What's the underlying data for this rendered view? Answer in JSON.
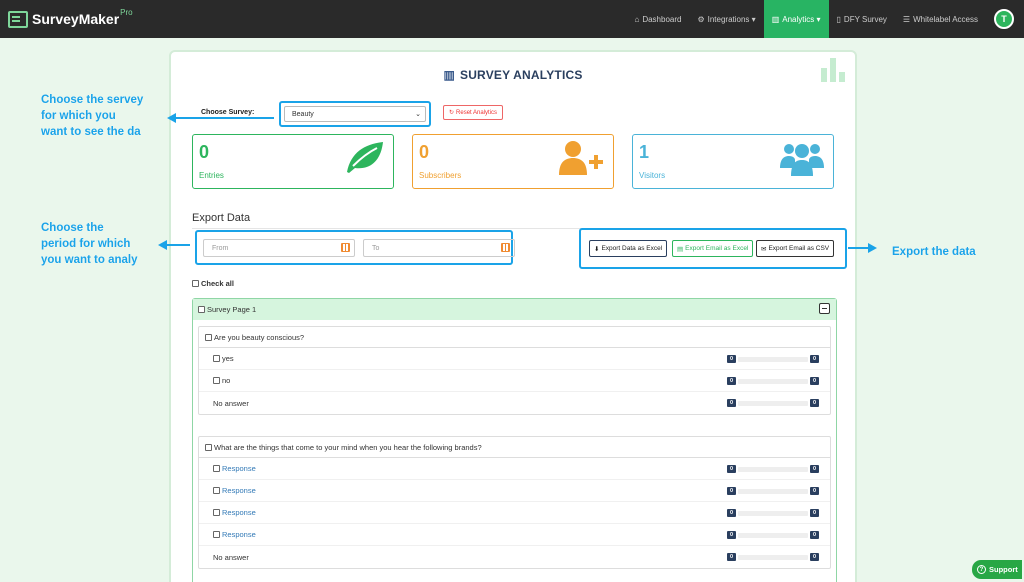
{
  "brand": {
    "name": "SurveyMaker",
    "tag": "Pro"
  },
  "nav": [
    {
      "icon": "home-icon",
      "glyph": "⌂",
      "label": "Dashboard",
      "caret": ""
    },
    {
      "icon": "cogs-icon",
      "glyph": "⚙",
      "label": "Integrations",
      "caret": "▾"
    },
    {
      "icon": "chart-icon",
      "glyph": "▥",
      "label": "Analytics",
      "caret": "▾"
    },
    {
      "icon": "file-icon",
      "glyph": "▯",
      "label": "DFY Survey",
      "caret": ""
    },
    {
      "icon": "list-icon",
      "glyph": "☰",
      "label": "Whitelabel Access",
      "caret": ""
    }
  ],
  "user": {
    "initial": "T"
  },
  "page": {
    "title": "SURVEY ANALYTICS"
  },
  "survey": {
    "label": "Choose Survey:",
    "selected": "Beauty",
    "reset_label": "Reset Analytics"
  },
  "stats": {
    "entries": {
      "value": "0",
      "label": "Entries"
    },
    "subscribers": {
      "value": "0",
      "label": "Subscribers"
    },
    "visitors": {
      "value": "1",
      "label": "Visitors"
    }
  },
  "export": {
    "title": "Export Data",
    "from_placeholder": "From",
    "to_placeholder": "To",
    "btn_excel": "Export Data as Excel",
    "btn_email_excel": "Export Email as Excel",
    "btn_email_csv": "Export Email as CSV"
  },
  "check_all": "Check all",
  "survey_page": {
    "label": "Survey Page 1",
    "questions": [
      {
        "text": "Are you beauty conscious?",
        "rows": [
          {
            "label": "yes",
            "checkbox": true,
            "link": false,
            "count_a": "0",
            "count_b": "0"
          },
          {
            "label": "no",
            "checkbox": true,
            "link": false,
            "count_a": "0",
            "count_b": "0"
          },
          {
            "label": "No answer",
            "checkbox": false,
            "link": false,
            "count_a": "0",
            "count_b": "0"
          }
        ]
      },
      {
        "text": "What are the things that come to your mind when you hear the following brands?",
        "rows": [
          {
            "label": "Response",
            "checkbox": true,
            "link": true,
            "count_a": "0",
            "count_b": "0"
          },
          {
            "label": "Response",
            "checkbox": true,
            "link": true,
            "count_a": "0",
            "count_b": "0"
          },
          {
            "label": "Response",
            "checkbox": true,
            "link": true,
            "count_a": "0",
            "count_b": "0"
          },
          {
            "label": "Response",
            "checkbox": true,
            "link": true,
            "count_a": "0",
            "count_b": "0"
          },
          {
            "label": "No answer",
            "checkbox": false,
            "link": false,
            "count_a": "0",
            "count_b": "0"
          }
        ]
      }
    ]
  },
  "annotations": {
    "survey_note": [
      "Choose the servey",
      "for which you",
      "want to see the da"
    ],
    "period_note": [
      "Choose the",
      "period for which",
      "you want to analy"
    ],
    "export_note": "Export the data"
  },
  "support": {
    "label": "Support"
  },
  "colors": {
    "accent": "#28b463",
    "annotation": "#1aa3e8",
    "navbar": "#2a2a2a"
  }
}
